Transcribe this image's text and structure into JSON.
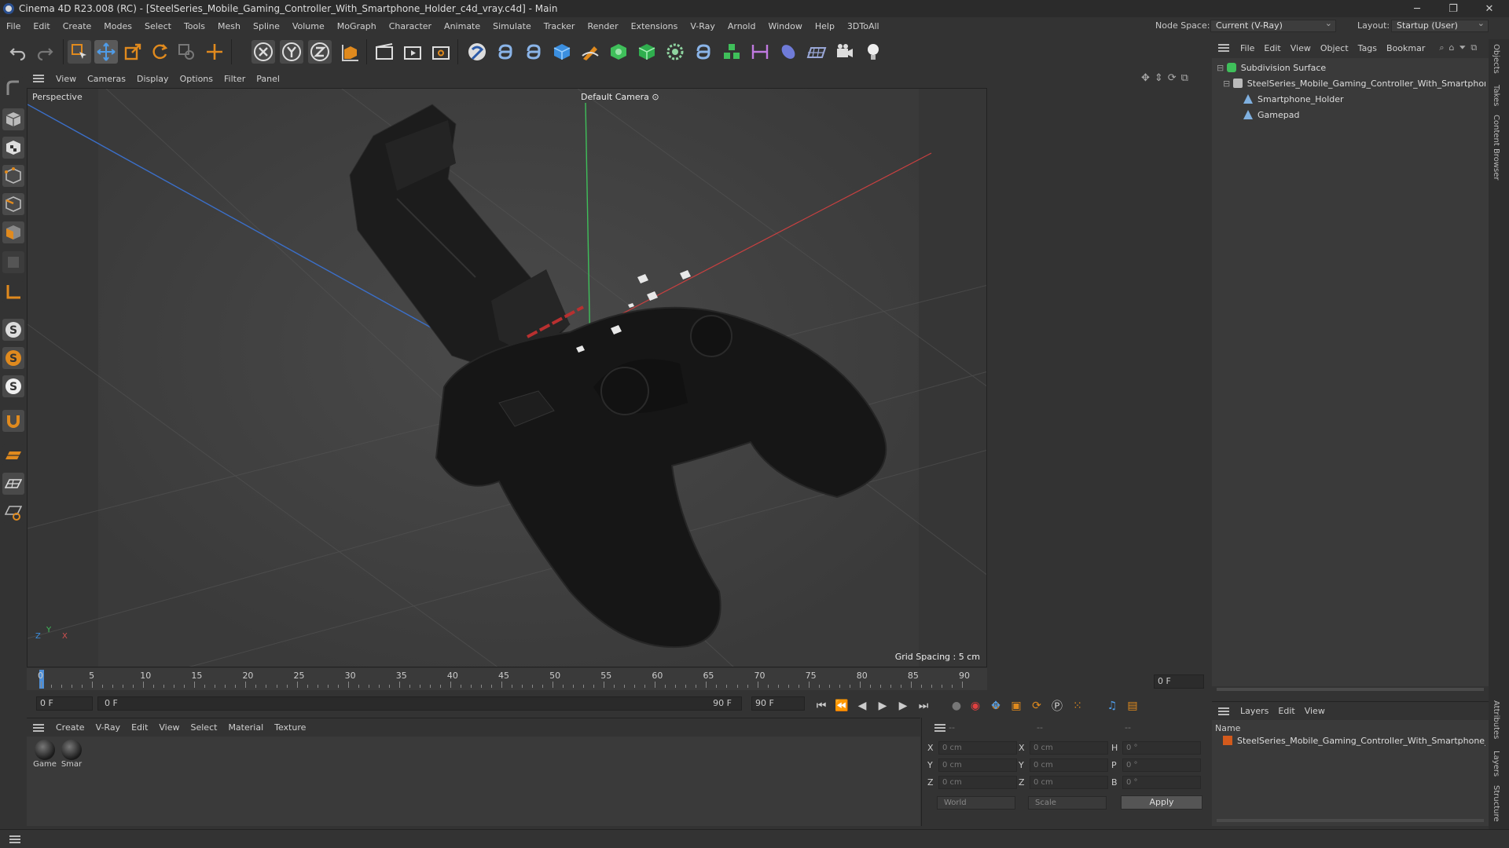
{
  "window": {
    "title": "Cinema 4D R23.008 (RC) - [SteelSeries_Mobile_Gaming_Controller_With_Smartphone_Holder_c4d_vray.c4d] - Main",
    "minimize": "─",
    "maximize": "❐",
    "close": "✕"
  },
  "menubar": {
    "items": [
      "File",
      "Edit",
      "Create",
      "Modes",
      "Select",
      "Tools",
      "Mesh",
      "Spline",
      "Volume",
      "MoGraph",
      "Character",
      "Animate",
      "Simulate",
      "Tracker",
      "Render",
      "Extensions",
      "V-Ray",
      "Arnold",
      "Window",
      "Help",
      "3DToAll"
    ],
    "node_space_label": "Node Space:",
    "node_space_value": "Current (V-Ray)",
    "layout_label": "Layout:",
    "layout_value": "Startup (User)"
  },
  "viewport": {
    "menu": [
      "View",
      "Cameras",
      "Display",
      "Options",
      "Filter",
      "Panel"
    ],
    "label": "Perspective",
    "camera": "Default Camera",
    "grid_spacing": "Grid Spacing : 5 cm",
    "axis_x": "X",
    "axis_y": "Y",
    "axis_z": "Z"
  },
  "timeline": {
    "ticks": [
      "0",
      "5",
      "10",
      "15",
      "20",
      "25",
      "30",
      "35",
      "40",
      "45",
      "50",
      "55",
      "60",
      "65",
      "70",
      "75",
      "80",
      "85",
      "90"
    ],
    "current_frame_field": "0 F",
    "start_field": "0 F",
    "range_start": "0 F",
    "range_end": "90 F",
    "end_field": "90 F"
  },
  "materials": {
    "menu": [
      "Create",
      "V-Ray",
      "Edit",
      "View",
      "Select",
      "Material",
      "Texture"
    ],
    "items": [
      {
        "label": "Game"
      },
      {
        "label": "Smar"
      }
    ]
  },
  "coordinates": {
    "header_a": "--",
    "header_b": "--",
    "header_c": "--",
    "rows": [
      {
        "axis": "X",
        "pos": "0 cm",
        "axis2": "X",
        "size": "0 cm",
        "rot_axis": "H",
        "rot": "0 °"
      },
      {
        "axis": "Y",
        "pos": "0 cm",
        "axis2": "Y",
        "size": "0 cm",
        "rot_axis": "P",
        "rot": "0 °"
      },
      {
        "axis": "Z",
        "pos": "0 cm",
        "axis2": "Z",
        "size": "0 cm",
        "rot_axis": "B",
        "rot": "0 °"
      }
    ],
    "coord_system": "World",
    "mode": "Scale",
    "apply": "Apply"
  },
  "objects": {
    "menu": [
      "File",
      "Edit",
      "View",
      "Object",
      "Tags",
      "Bookmar"
    ],
    "tree": [
      {
        "name": "Subdivision Surface",
        "level": 0
      },
      {
        "name": "SteelSeries_Mobile_Gaming_Controller_With_Smartphone_Holder",
        "level": 1
      },
      {
        "name": "Smartphone_Holder",
        "level": 2
      },
      {
        "name": "Gamepad",
        "level": 2
      }
    ]
  },
  "layers": {
    "menu": [
      "Layers",
      "Edit",
      "View"
    ],
    "column": "Name",
    "items": [
      "SteelSeries_Mobile_Gaming_Controller_With_Smartphone_Holder"
    ],
    "layer_color": "#d35a1c"
  },
  "right_tabs": [
    "Objects",
    "Takes",
    "Content Browser",
    "Attributes",
    "Layers",
    "Structure"
  ],
  "colors": {
    "accent_blue": "#3b6fc9",
    "accent_orange": "#e08a1e",
    "axis_x": "#c84040",
    "axis_y": "#3fbf5a",
    "axis_z": "#3b6fc9"
  }
}
